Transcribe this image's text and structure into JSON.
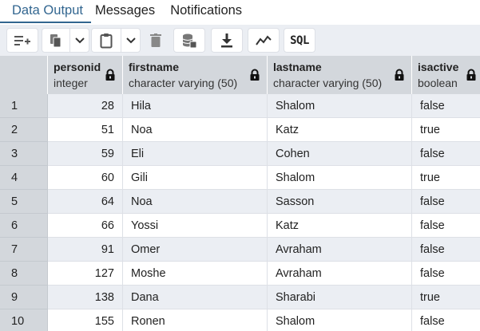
{
  "tabs": [
    {
      "label": "Data Output",
      "active": true
    },
    {
      "label": "Messages",
      "active": false
    },
    {
      "label": "Notifications",
      "active": false
    }
  ],
  "toolbar": {
    "icons": [
      "add-row-icon",
      "copy-icon",
      "chevron-down-icon",
      "paste-icon",
      "chevron-down-icon",
      "delete-icon",
      "save-data-icon",
      "download-icon",
      "graph-icon",
      "sql-icon"
    ],
    "sql_label": "SQL"
  },
  "columns": [
    {
      "name": "personid",
      "type": "integer"
    },
    {
      "name": "firstname",
      "type": "character varying (50)"
    },
    {
      "name": "lastname",
      "type": "character varying (50)"
    },
    {
      "name": "isactive",
      "type": "boolean"
    }
  ],
  "rows": [
    {
      "n": "1",
      "personid": "28",
      "firstname": "Hila",
      "lastname": "Shalom",
      "isactive": "false"
    },
    {
      "n": "2",
      "personid": "51",
      "firstname": "Noa",
      "lastname": "Katz",
      "isactive": "true"
    },
    {
      "n": "3",
      "personid": "59",
      "firstname": "Eli",
      "lastname": "Cohen",
      "isactive": "false"
    },
    {
      "n": "4",
      "personid": "60",
      "firstname": "Gili",
      "lastname": "Shalom",
      "isactive": "true"
    },
    {
      "n": "5",
      "personid": "64",
      "firstname": "Noa",
      "lastname": "Sasson",
      "isactive": "false"
    },
    {
      "n": "6",
      "personid": "66",
      "firstname": "Yossi",
      "lastname": "Katz",
      "isactive": "false"
    },
    {
      "n": "7",
      "personid": "91",
      "firstname": "Omer",
      "lastname": "Avraham",
      "isactive": "false"
    },
    {
      "n": "8",
      "personid": "127",
      "firstname": "Moshe",
      "lastname": "Avraham",
      "isactive": "false"
    },
    {
      "n": "9",
      "personid": "138",
      "firstname": "Dana",
      "lastname": "Sharabi",
      "isactive": "true"
    },
    {
      "n": "10",
      "personid": "155",
      "firstname": "Ronen",
      "lastname": "Shalom",
      "isactive": "false"
    }
  ],
  "colors": {
    "accent": "#326690",
    "header_bg": "#d3d7dc",
    "alt_row_bg": "#ebeef3",
    "toolbar_bg": "#ebeef3"
  }
}
